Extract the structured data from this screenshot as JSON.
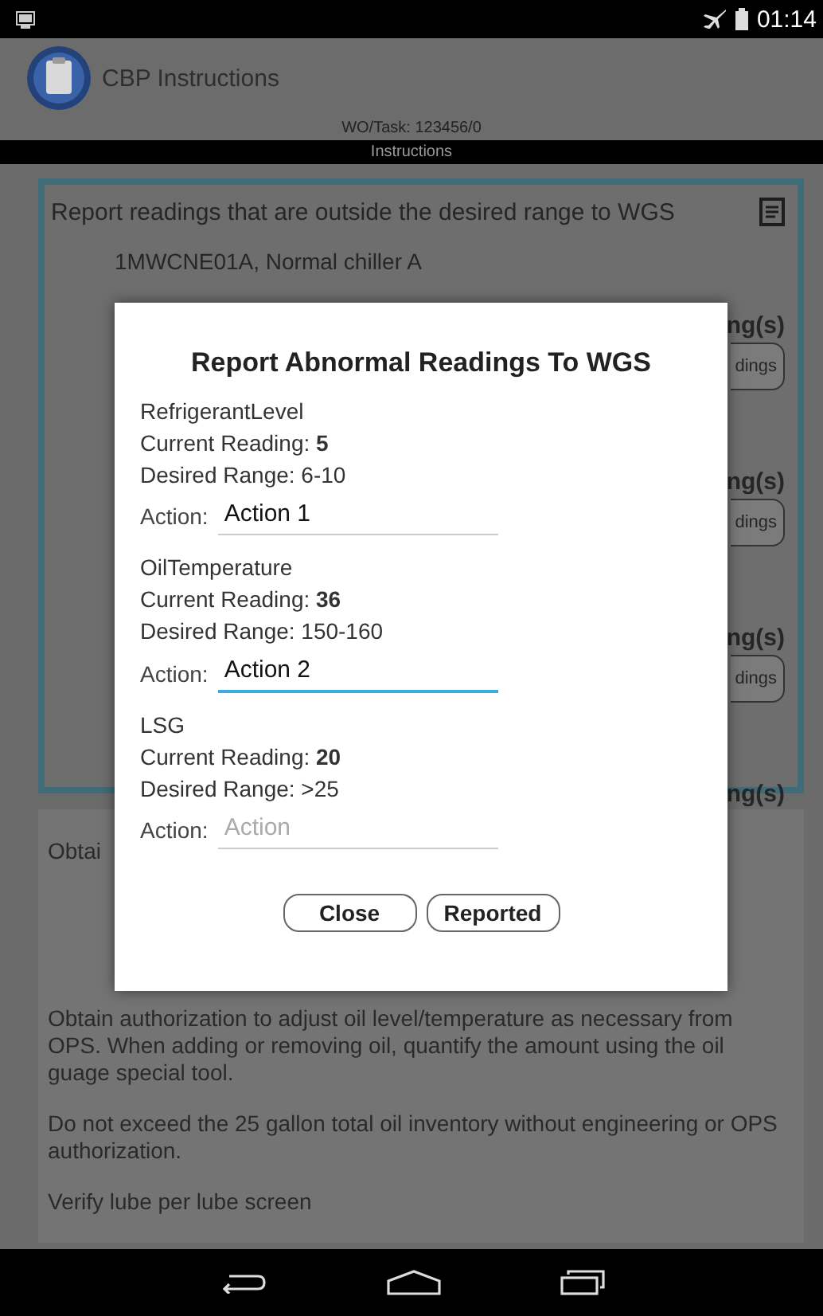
{
  "status_bar": {
    "time": "01:14"
  },
  "app_bar": {
    "title": "CBP Instructions"
  },
  "header": {
    "wo_task": "WO/Task: 123456/0",
    "section": "Instructions"
  },
  "panel": {
    "prompt": "Report readings that are outside the desired range to WGS",
    "equipment": "1MWCNE01A, Normal chiller A",
    "rows": [
      {
        "label": "ng(s)",
        "button": "dings"
      },
      {
        "label": "ng(s)",
        "button": "dings"
      },
      {
        "label": "ng(s)",
        "button": "dings"
      },
      {
        "label": "ng(s)"
      }
    ]
  },
  "notes": {
    "obscured_start": "Obtai",
    "paragraphs": [
      "Obtain authorization to adjust oil level/temperature as necessary from OPS. When adding or removing oil, quantify the amount using the oil guage special tool.",
      "Do not exceed the 25 gallon total oil inventory without engineering or OPS authorization.",
      "Verify lube per lube screen"
    ]
  },
  "dialog": {
    "title": "Report Abnormal Readings To WGS",
    "readings": [
      {
        "name": "RefrigerantLevel",
        "current": "Current Reading: **5**",
        "range": "Desired Range: 6-10",
        "action_label": "Action:",
        "value": "Action 1",
        "focused": false
      },
      {
        "name": "OilTemperature",
        "current": "Current Reading: **36**",
        "range": "Desired Range: 150-160",
        "action_label": "Action:",
        "value": "Action 2",
        "focused": true
      },
      {
        "name": "LSG",
        "current": "Current Reading: **20**",
        "range": "Desired Range: >25",
        "action_label": "Action:",
        "placeholder": "Action",
        "focused": false
      }
    ],
    "buttons": [
      "Close",
      "Reported"
    ]
  }
}
